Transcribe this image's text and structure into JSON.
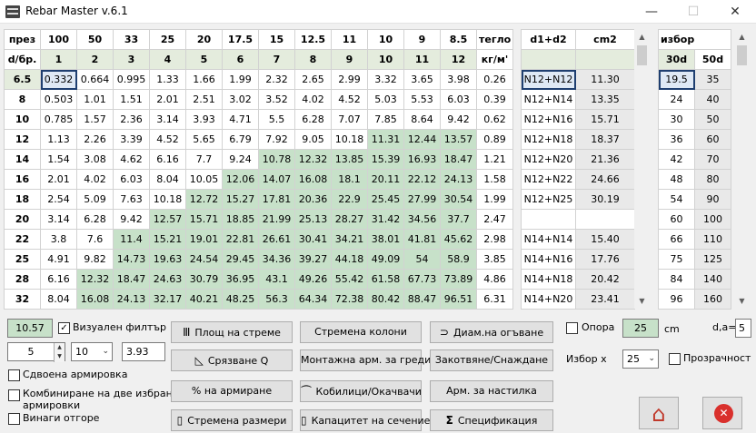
{
  "window": {
    "title": "Rebar Master v.6.1",
    "minimize": "—",
    "maximize": "☐",
    "close": "✕"
  },
  "main_table": {
    "header1": [
      "през",
      "100",
      "50",
      "33",
      "25",
      "20",
      "17.5",
      "15",
      "12.5",
      "11",
      "10",
      "9",
      "8.5",
      "тегло"
    ],
    "header2": [
      "d/бр.",
      "1",
      "2",
      "3",
      "4",
      "5",
      "6",
      "7",
      "8",
      "9",
      "10",
      "11",
      "12",
      "кг/м'"
    ],
    "rows": [
      [
        "6.5",
        "0.332",
        "0.664",
        "0.995",
        "1.33",
        "1.66",
        "1.99",
        "2.32",
        "2.65",
        "2.99",
        "3.32",
        "3.65",
        "3.98",
        "0.26"
      ],
      [
        "8",
        "0.503",
        "1.01",
        "1.51",
        "2.01",
        "2.51",
        "3.02",
        "3.52",
        "4.02",
        "4.52",
        "5.03",
        "5.53",
        "6.03",
        "0.39"
      ],
      [
        "10",
        "0.785",
        "1.57",
        "2.36",
        "3.14",
        "3.93",
        "4.71",
        "5.5",
        "6.28",
        "7.07",
        "7.85",
        "8.64",
        "9.42",
        "0.62"
      ],
      [
        "12",
        "1.13",
        "2.26",
        "3.39",
        "4.52",
        "5.65",
        "6.79",
        "7.92",
        "9.05",
        "10.18",
        "11.31",
        "12.44",
        "13.57",
        "0.89"
      ],
      [
        "14",
        "1.54",
        "3.08",
        "4.62",
        "6.16",
        "7.7",
        "9.24",
        "10.78",
        "12.32",
        "13.85",
        "15.39",
        "16.93",
        "18.47",
        "1.21"
      ],
      [
        "16",
        "2.01",
        "4.02",
        "6.03",
        "8.04",
        "10.05",
        "12.06",
        "14.07",
        "16.08",
        "18.1",
        "20.11",
        "22.12",
        "24.13",
        "1.58"
      ],
      [
        "18",
        "2.54",
        "5.09",
        "7.63",
        "10.18",
        "12.72",
        "15.27",
        "17.81",
        "20.36",
        "22.9",
        "25.45",
        "27.99",
        "30.54",
        "1.99"
      ],
      [
        "20",
        "3.14",
        "6.28",
        "9.42",
        "12.57",
        "15.71",
        "18.85",
        "21.99",
        "25.13",
        "28.27",
        "31.42",
        "34.56",
        "37.7",
        "2.47"
      ],
      [
        "22",
        "3.8",
        "7.6",
        "11.4",
        "15.21",
        "19.01",
        "22.81",
        "26.61",
        "30.41",
        "34.21",
        "38.01",
        "41.81",
        "45.62",
        "2.98"
      ],
      [
        "25",
        "4.91",
        "9.82",
        "14.73",
        "19.63",
        "24.54",
        "29.45",
        "34.36",
        "39.27",
        "44.18",
        "49.09",
        "54",
        "58.9",
        "3.85"
      ],
      [
        "28",
        "6.16",
        "12.32",
        "18.47",
        "24.63",
        "30.79",
        "36.95",
        "43.1",
        "49.26",
        "55.42",
        "61.58",
        "67.73",
        "73.89",
        "4.86"
      ],
      [
        "32",
        "8.04",
        "16.08",
        "24.13",
        "32.17",
        "40.21",
        "48.25",
        "56.3",
        "64.34",
        "72.38",
        "80.42",
        "88.47",
        "96.51",
        "6.31"
      ]
    ]
  },
  "combo_table": {
    "headers": [
      "d1+d2",
      "cm2"
    ],
    "rows": [
      [
        "N12+N12",
        "11.30"
      ],
      [
        "N12+N14",
        "13.35"
      ],
      [
        "N12+N16",
        "15.71"
      ],
      [
        "N12+N18",
        "18.37"
      ],
      [
        "N12+N20",
        "21.36"
      ],
      [
        "N12+N22",
        "24.66"
      ],
      [
        "N12+N25",
        "30.19"
      ],
      [
        "",
        ""
      ],
      [
        "N14+N14",
        "15.40"
      ],
      [
        "N14+N16",
        "17.76"
      ],
      [
        "N14+N18",
        "20.42"
      ],
      [
        "N14+N20",
        "23.41"
      ]
    ]
  },
  "anchor_table": {
    "header": "избор",
    "subheaders": [
      "30d",
      "50d"
    ],
    "rows": [
      [
        "19.5",
        "35"
      ],
      [
        "24",
        "40"
      ],
      [
        "30",
        "50"
      ],
      [
        "36",
        "60"
      ],
      [
        "42",
        "70"
      ],
      [
        "48",
        "80"
      ],
      [
        "54",
        "90"
      ],
      [
        "60",
        "100"
      ],
      [
        "66",
        "110"
      ],
      [
        "75",
        "125"
      ],
      [
        "84",
        "140"
      ],
      [
        "96",
        "160"
      ]
    ]
  },
  "controls": {
    "filter_value": "10.57",
    "visual_filter_label": "Визуален филтър",
    "visual_filter_checked": "✓",
    "spinner_value": "5",
    "spacing_value": "10",
    "result_value": "3.93",
    "double_reinf_label": "Сдвоена армировка",
    "combine_label_1": "Комбиниране на две избрани",
    "combine_label_2": "армировки",
    "always_deduct_label": "Винаги отгоре",
    "support_label": "Опора",
    "support_value": "25",
    "support_unit": "cm",
    "da_label": "d,a=",
    "da_value": "5",
    "choice_label": "Избор x",
    "choice_value": "25",
    "transparency_label": "Прозрачност"
  },
  "buttons": {
    "stirrup_area": "Площ на стреме",
    "shear_q": "Срязване Q",
    "reinf_percent": "% на армиране",
    "stirrup_sizes": "Стремена размери",
    "column_stirrups": "Стремена колони",
    "beam_assembly": "Монтажна арм. за греди",
    "cavalier_hangers": "Кобилици/Окачвачи",
    "section_capacity": "Капацитет на сечение",
    "bend_diameter": "Диам.на огъване",
    "anchorage_splice": "Закотвяне/Снаждане",
    "slab_reinf": "Арм. за настилка",
    "specification": "Спецификация"
  },
  "icons": {
    "stirrup_area": "Ⅲ",
    "shear_q": "◺",
    "stirrup_sizes": "▯",
    "cavalier_hangers": "⏜",
    "section_capacity": "▯",
    "bend_diameter": "⊃",
    "specification": "Σ",
    "home": "⌂",
    "exit": "✕"
  },
  "colors": {
    "highlight_green": "#c7e1c9",
    "header_green": "#e4ecdd",
    "exit_red": "#d9302c",
    "home_red": "#c0392b"
  }
}
